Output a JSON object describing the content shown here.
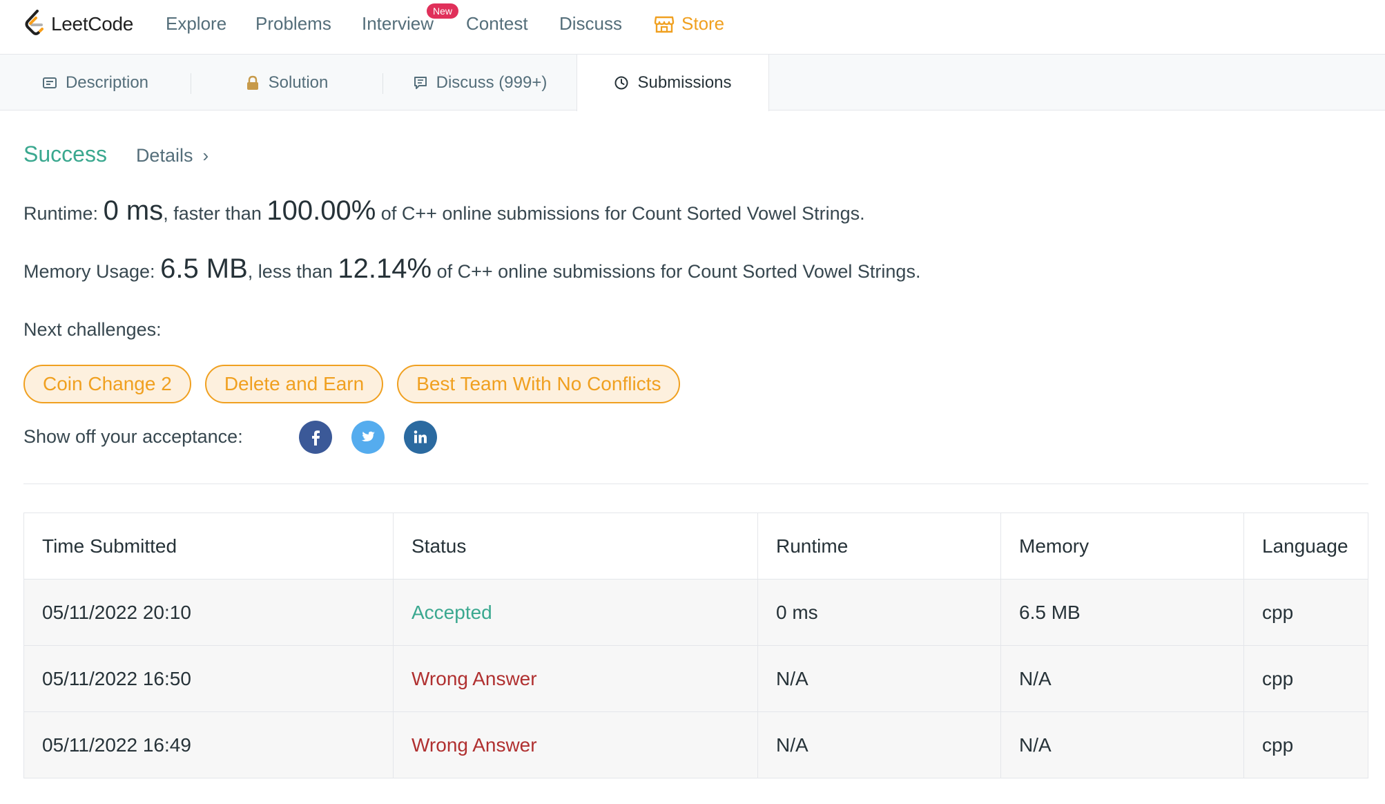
{
  "brand": {
    "name": "LeetCode"
  },
  "nav": {
    "explore": "Explore",
    "problems": "Problems",
    "interview": "Interview",
    "interview_badge": "New",
    "contest": "Contest",
    "discuss": "Discuss",
    "store": "Store"
  },
  "tabs": {
    "description": "Description",
    "solution": "Solution",
    "discuss": "Discuss (999+)",
    "submissions": "Submissions"
  },
  "result": {
    "status": "Success",
    "details": "Details",
    "runtime_label": "Runtime:",
    "runtime_value": "0 ms",
    "runtime_mid": ", faster than",
    "runtime_pct": "100.00%",
    "runtime_tail": "of C++ online submissions for Count Sorted Vowel Strings.",
    "memory_label": "Memory Usage:",
    "memory_value": "6.5 MB",
    "memory_mid": ", less than",
    "memory_pct": "12.14%",
    "memory_tail": "of C++ online submissions for Count Sorted Vowel Strings."
  },
  "next_challenges": {
    "label": "Next challenges:",
    "items": [
      "Coin Change 2",
      "Delete and Earn",
      "Best Team With No Conflicts"
    ]
  },
  "share": {
    "label": "Show off your acceptance:",
    "icons": [
      "facebook-icon",
      "twitter-icon",
      "linkedin-icon"
    ]
  },
  "table": {
    "headers": [
      "Time Submitted",
      "Status",
      "Runtime",
      "Memory",
      "Language"
    ],
    "rows": [
      {
        "time": "05/11/2022 20:10",
        "status": "Accepted",
        "runtime": "0 ms",
        "memory": "6.5 MB",
        "language": "cpp"
      },
      {
        "time": "05/11/2022 16:50",
        "status": "Wrong Answer",
        "runtime": "N/A",
        "memory": "N/A",
        "language": "cpp"
      },
      {
        "time": "05/11/2022 16:49",
        "status": "Wrong Answer",
        "runtime": "N/A",
        "memory": "N/A",
        "language": "cpp"
      }
    ]
  },
  "colors": {
    "accent_orange": "#f0a020",
    "success_green": "#3aa88f",
    "error_red": "#b03030",
    "badge_pink": "#e0305a"
  }
}
